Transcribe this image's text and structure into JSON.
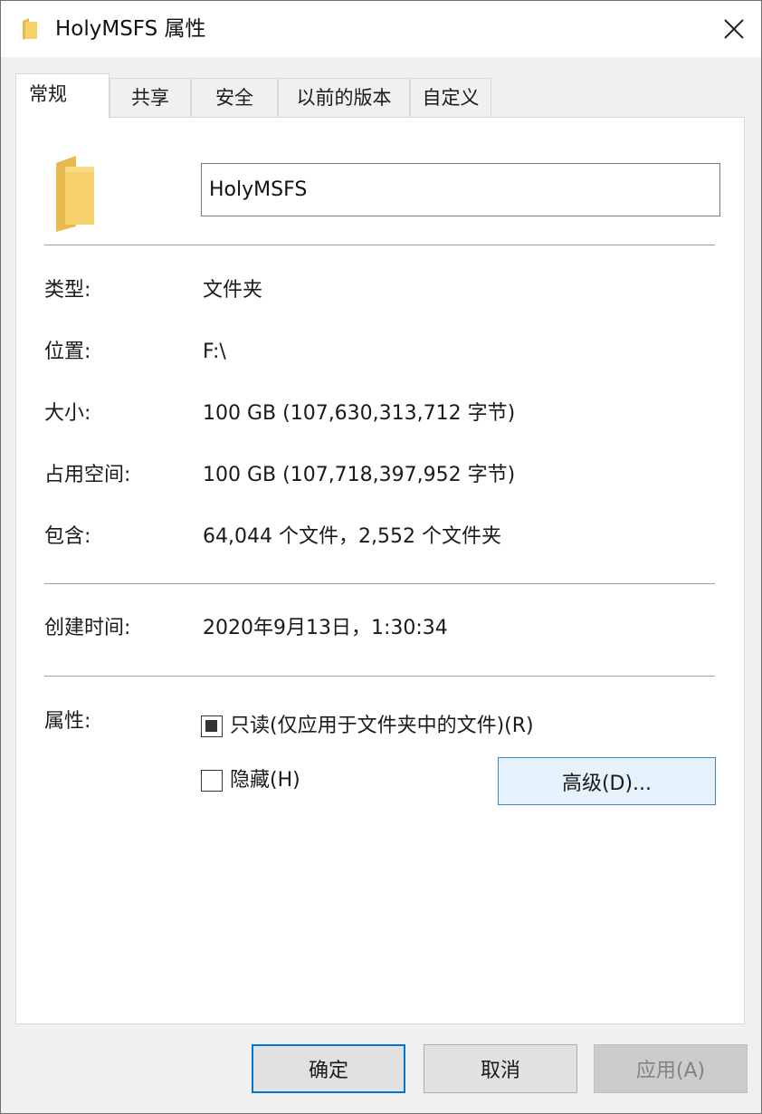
{
  "window": {
    "title": "HolyMSFS 属性",
    "close_icon": "close-icon"
  },
  "tabs": [
    {
      "label": "常规",
      "active": true
    },
    {
      "label": "共享",
      "active": false
    },
    {
      "label": "安全",
      "active": false
    },
    {
      "label": "以前的版本",
      "active": false
    },
    {
      "label": "自定义",
      "active": false
    }
  ],
  "general": {
    "folder_name": "HolyMSFS",
    "folder_icon": "folder-icon",
    "folder_color": "#f6d16b",
    "type_label": "类型:",
    "type_value": "文件夹",
    "location_label": "位置:",
    "location_value": "F:\\",
    "size_label": "大小:",
    "size_value": "100 GB (107,630,313,712 字节)",
    "disk_size_label": "占用空间:",
    "disk_size_value": "100 GB (107,718,397,952 字节)",
    "contains_label": "包含:",
    "contains_value": "64,044 个文件，2,552 个文件夹",
    "created_label": "创建时间:",
    "created_value": "2020年9月13日，1:30:34",
    "attributes_label": "属性:",
    "readonly_label": "只读(仅应用于文件夹中的文件)(R)",
    "readonly_state": "indeterminate",
    "hidden_label": "隐藏(H)",
    "hidden_checked": false,
    "advanced_label": "高级(D)..."
  },
  "footer": {
    "ok_label": "确定",
    "cancel_label": "取消",
    "apply_label": "应用(A)"
  },
  "colors": {
    "accent": "#0078d7",
    "advanced_bg": "#e5f1fb",
    "disabled_text": "#838383"
  }
}
